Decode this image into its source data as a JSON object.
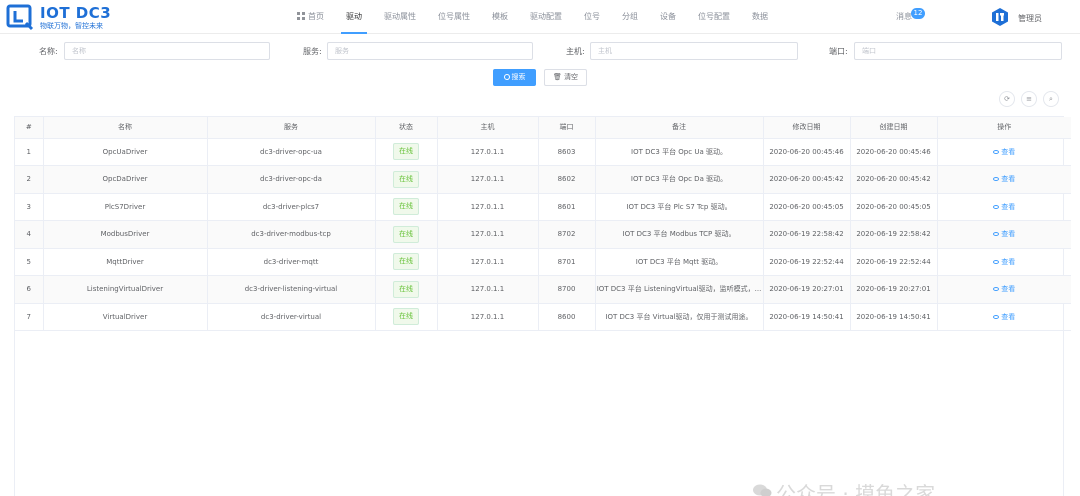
{
  "header": {
    "logo_title": "IOT DC3",
    "logo_subtitle": "物联万物，智控未来",
    "nav": [
      {
        "label": "首页",
        "active": false,
        "icon": "home-grid-icon"
      },
      {
        "label": "驱动",
        "active": true
      },
      {
        "label": "驱动属性",
        "active": false
      },
      {
        "label": "位号属性",
        "active": false
      },
      {
        "label": "模板",
        "active": false
      },
      {
        "label": "驱动配置",
        "active": false
      },
      {
        "label": "位号",
        "active": false
      },
      {
        "label": "分组",
        "active": false
      },
      {
        "label": "设备",
        "active": false
      },
      {
        "label": "位号配置",
        "active": false
      },
      {
        "label": "数据",
        "active": false
      }
    ],
    "messages_label": "消息",
    "messages_count": "12",
    "user_name": "管理员"
  },
  "search": {
    "name_label": "名称:",
    "name_placeholder": "名称",
    "service_label": "服务:",
    "service_placeholder": "服务",
    "host_label": "主机:",
    "host_placeholder": "主机",
    "port_label": "端口:",
    "port_placeholder": "端口",
    "search_button": "搜索",
    "clear_button": "清空"
  },
  "table": {
    "columns": [
      "#",
      "名称",
      "服务",
      "状态",
      "主机",
      "端口",
      "备注",
      "修改日期",
      "创建日期",
      "操作"
    ],
    "view_label": "查看",
    "rows": [
      {
        "index": "1",
        "name": "OpcUaDriver",
        "service": "dc3-driver-opc-ua",
        "status": "在线",
        "host": "127.0.1.1",
        "port": "8603",
        "remark": "IOT DC3 平台 Opc Ua 驱动。",
        "updated": "2020-06-20 00:45:46",
        "created": "2020-06-20 00:45:46"
      },
      {
        "index": "2",
        "name": "OpcDaDriver",
        "service": "dc3-driver-opc-da",
        "status": "在线",
        "host": "127.0.1.1",
        "port": "8602",
        "remark": "IOT DC3 平台 Opc Da 驱动。",
        "updated": "2020-06-20 00:45:42",
        "created": "2020-06-20 00:45:42"
      },
      {
        "index": "3",
        "name": "PlcS7Driver",
        "service": "dc3-driver-plcs7",
        "status": "在线",
        "host": "127.0.1.1",
        "port": "8601",
        "remark": "IOT DC3 平台 Plc S7 Tcp 驱动。",
        "updated": "2020-06-20 00:45:05",
        "created": "2020-06-20 00:45:05"
      },
      {
        "index": "4",
        "name": "ModbusDriver",
        "service": "dc3-driver-modbus-tcp",
        "status": "在线",
        "host": "127.0.1.1",
        "port": "8702",
        "remark": "IOT DC3 平台 Modbus TCP 驱动。",
        "updated": "2020-06-19 22:58:42",
        "created": "2020-06-19 22:58:42"
      },
      {
        "index": "5",
        "name": "MqttDriver",
        "service": "dc3-driver-mqtt",
        "status": "在线",
        "host": "127.0.1.1",
        "port": "8701",
        "remark": "IOT DC3 平台 Mqtt 驱动。",
        "updated": "2020-06-19 22:52:44",
        "created": "2020-06-19 22:52:44"
      },
      {
        "index": "6",
        "name": "ListeningVirtualDriver",
        "service": "dc3-driver-listening-virtual",
        "status": "在线",
        "host": "127.0.1.1",
        "port": "8700",
        "remark": "IOT DC3 平台 ListeningVirtual驱动，监听模式，...",
        "updated": "2020-06-19 20:27:01",
        "created": "2020-06-19 20:27:01"
      },
      {
        "index": "7",
        "name": "VirtualDriver",
        "service": "dc3-driver-virtual",
        "status": "在线",
        "host": "127.0.1.1",
        "port": "8600",
        "remark": "IOT DC3 平台 Virtual驱动，仅用于测试用途。",
        "updated": "2020-06-19 14:50:41",
        "created": "2020-06-19 14:50:41"
      }
    ]
  },
  "watermark": "公众号 · 摸鱼之家",
  "colors": {
    "primary": "#409eff",
    "success": "#67c23a",
    "logo": "#1e6fd6"
  }
}
